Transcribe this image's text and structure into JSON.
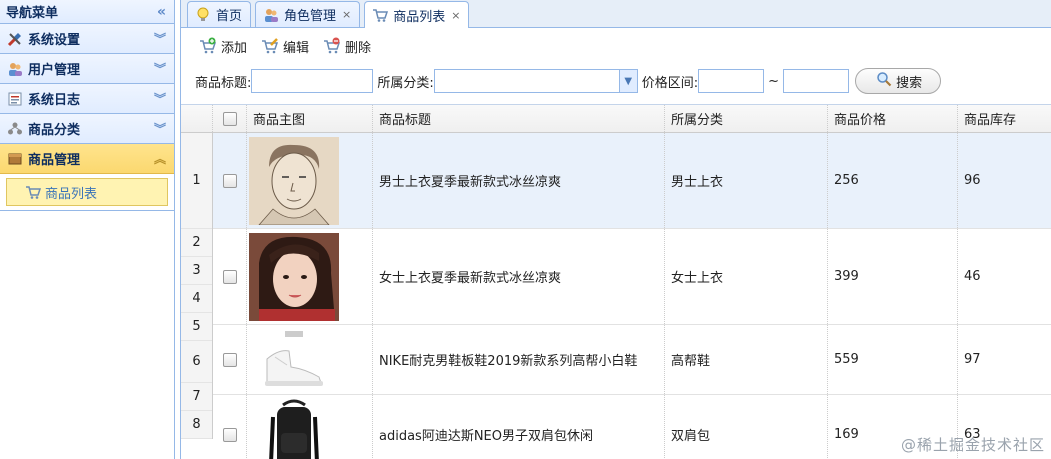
{
  "sidebar": {
    "title": "导航菜单",
    "collapse_icon": "double-chevron-left-icon",
    "sections": [
      {
        "label": "系统设置",
        "icon": "tools-icon",
        "active": false
      },
      {
        "label": "用户管理",
        "icon": "users-icon",
        "active": false
      },
      {
        "label": "系统日志",
        "icon": "log-icon",
        "active": false
      },
      {
        "label": "商品分类",
        "icon": "org-icon",
        "active": false
      },
      {
        "label": "商品管理",
        "icon": "box-icon",
        "active": true
      }
    ],
    "sub_items": [
      {
        "label": "商品列表",
        "icon": "cart-icon"
      }
    ]
  },
  "tabs": [
    {
      "label": "首页",
      "icon": "bulb-icon",
      "closable": false,
      "active": false
    },
    {
      "label": "角色管理",
      "icon": "users-icon",
      "closable": true,
      "active": false
    },
    {
      "label": "商品列表",
      "icon": "cart-icon",
      "closable": true,
      "active": true
    }
  ],
  "tab_close_glyph": "×",
  "toolbar": {
    "add": "添加",
    "edit": "编辑",
    "delete": "删除"
  },
  "search": {
    "title_label": "商品标题:",
    "category_label": "所属分类:",
    "price_label": "价格区间:",
    "range_sep": "~",
    "button": "搜索",
    "title_value": "",
    "category_value": "",
    "price_min": "",
    "price_max": ""
  },
  "grid": {
    "columns": [
      "商品主图",
      "商品标题",
      "所属分类",
      "商品价格",
      "商品库存"
    ],
    "row_numbers": [
      "1",
      "2",
      "3",
      "4",
      "5",
      "6",
      "7",
      "8"
    ],
    "rows": [
      {
        "title": "男士上衣夏季最新款式冰丝凉爽",
        "category": "男士上衣",
        "price": "256",
        "stock": "96",
        "image": "man-portrait-sketch",
        "selected": true
      },
      {
        "title": "女士上衣夏季最新款式冰丝凉爽",
        "category": "女士上衣",
        "price": "399",
        "stock": "46",
        "image": "woman-portrait-photo",
        "selected": false
      },
      {
        "title": "NIKE耐克男鞋板鞋2019新款系列高帮小白鞋",
        "category": "高帮鞋",
        "price": "559",
        "stock": "97",
        "image": "white-sneaker-photo",
        "selected": false
      },
      {
        "title": "adidas阿迪达斯NEO男子双肩包休闲",
        "category": "双肩包",
        "price": "169",
        "stock": "63",
        "image": "black-backpack-photo",
        "selected": false
      }
    ]
  },
  "watermark": "@稀土掘金技术社区"
}
